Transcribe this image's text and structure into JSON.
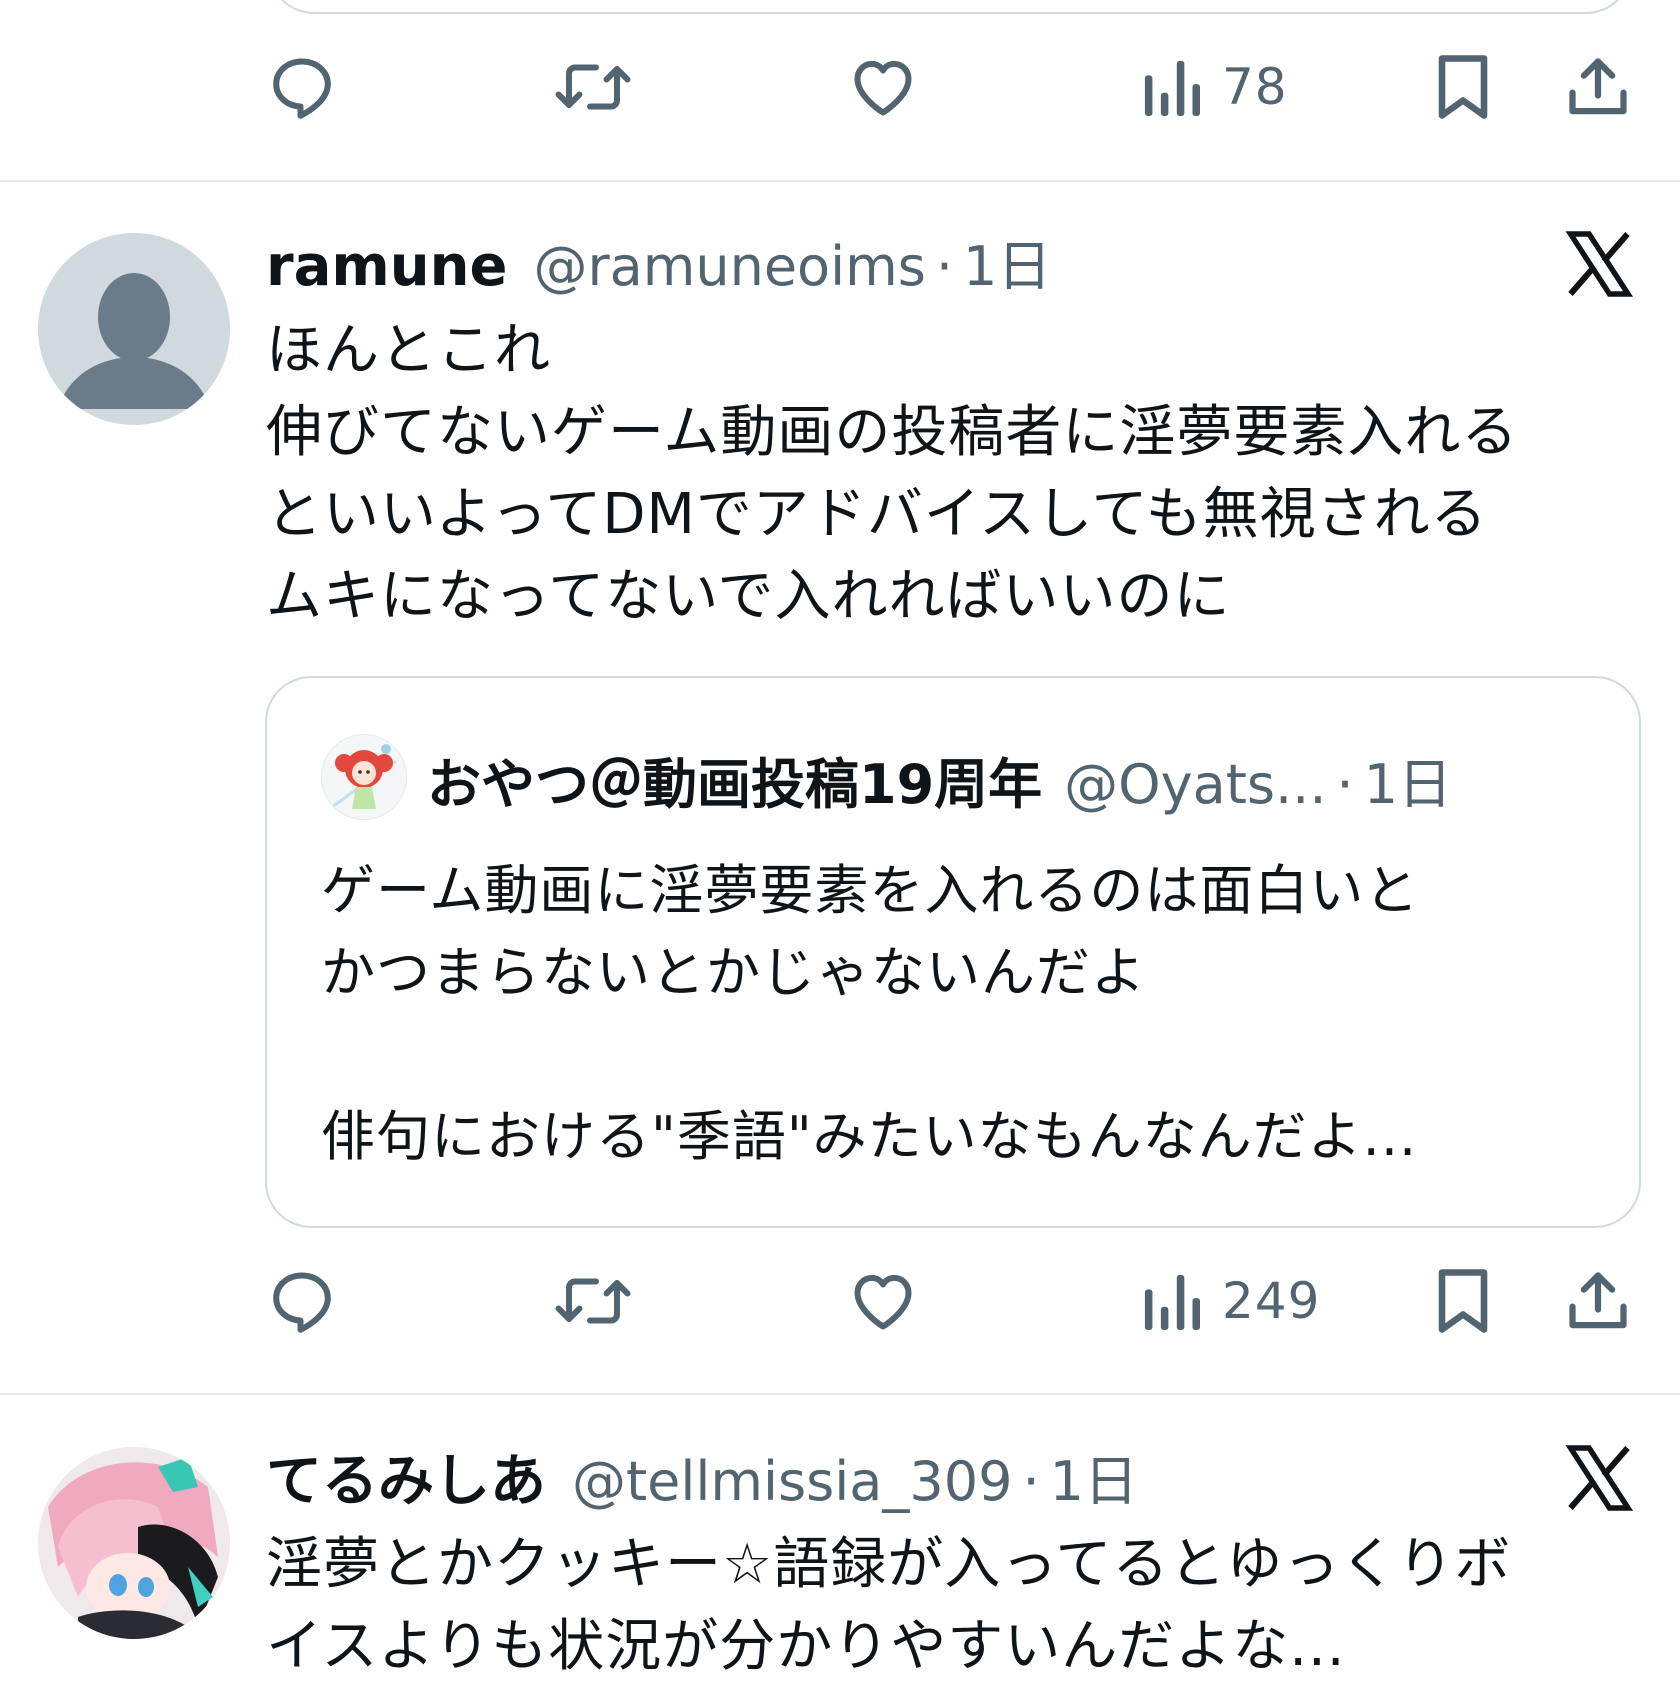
{
  "colors": {
    "icon": "#536471",
    "text": "#0f1419",
    "secondary": "#536471",
    "divider": "#e6e9ec",
    "avatar_placeholder_bg": "#cfd9de",
    "avatar_placeholder_fg": "#6a7b8a"
  },
  "top_actions": {
    "reply_icon": "speech-bubble-icon",
    "retweet_icon": "retweet-icon",
    "like_icon": "heart-icon",
    "views_icon": "bar-chart-icon",
    "views_count": "78",
    "bookmark_icon": "bookmark-icon",
    "share_icon": "share-icon"
  },
  "tweets": [
    {
      "name": "ramune",
      "handle": "@ramuneoims",
      "dot": "·",
      "time": "1日",
      "platform_icon": "x-logo-icon",
      "text_lines": [
        "ほんとこれ",
        "伸びてないゲーム動画の投稿者に淫夢要素入れる",
        "といいよってDMでアドバイスしても無視される",
        "ムキになってないで入れればいいのに"
      ],
      "quote": {
        "name": "おやつ＠動画投稿19周年",
        "handle": "@Oyats...",
        "dot": "·",
        "time": "1日",
        "text_lines": [
          "ゲーム動画に淫夢要素を入れるのは面白いと",
          "かつまらないとかじゃないんだよ",
          "",
          "俳句における\"季語\"みたいなもんなんだよ..."
        ]
      },
      "views_count": "249"
    },
    {
      "name": "てるみしあ",
      "handle": "@tellmissia_309",
      "dot": "·",
      "time": "1日",
      "platform_icon": "x-logo-icon",
      "text_lines": [
        "淫夢とかクッキー☆語録が入ってるとゆっくりボ",
        "イスよりも状況が分かりやすいんだよな..."
      ]
    }
  ]
}
